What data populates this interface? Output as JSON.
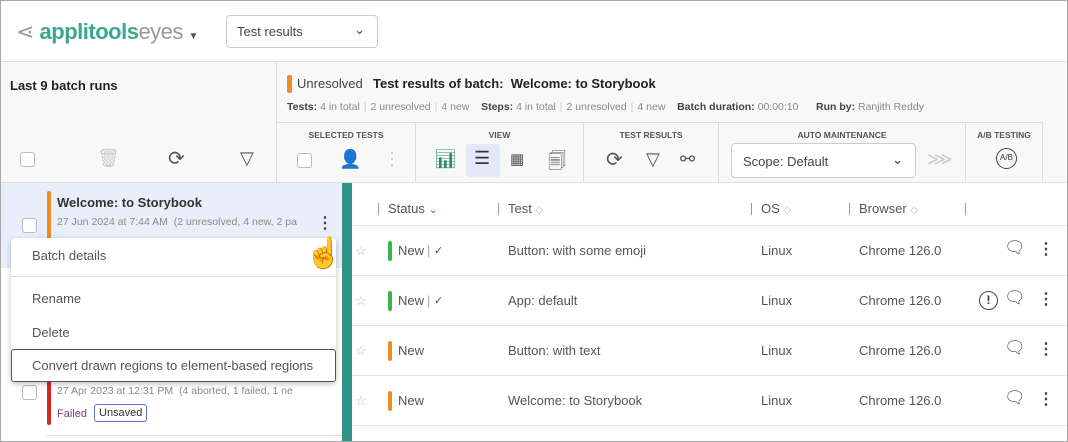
{
  "header": {
    "logo_main": "applitools",
    "logo_sub": "eyes",
    "page_select": "Test results"
  },
  "left": {
    "title": "Last 9 batch runs",
    "batches": [
      {
        "name": "Welcome: to Storybook",
        "date": "27 Jun 2024 at 7:44 AM",
        "summary": "(2 unresolved, 4 new, 2 pa",
        "color": "#f28c1e"
      },
      {
        "date": "27 Apr 2023 at 12:31 PM",
        "summary": "(4 aborted, 1 failed, 1 ne",
        "status": "Failed",
        "badge": "Unsaved",
        "color": "#d9261c"
      }
    ]
  },
  "batch": {
    "status": "Unresolved",
    "title": "Test results of batch:  Welcome: to Storybook",
    "tests_label": "Tests:",
    "tests_total": "4 in total",
    "tests_unresolved": "2 unresolved",
    "tests_new": "4 new",
    "steps_label": "Steps:",
    "steps_total": "4 in total",
    "steps_unresolved": "2 unresolved",
    "steps_new": "4 new",
    "duration_label": "Batch duration:",
    "duration": "00:00:10",
    "runby_label": "Run by:",
    "runby": "Ranjith Reddy"
  },
  "toolbar": {
    "selected_tests": "SELECTED TESTS",
    "view": "VIEW",
    "test_results": "TEST RESULTS",
    "auto_maintenance": "AUTO MAINTENANCE",
    "ab_testing": "A/B TESTING",
    "scope": "Scope: Default"
  },
  "menu": {
    "items": [
      "Batch details",
      "Rename",
      "Delete",
      "Convert drawn regions to element-based regions"
    ]
  },
  "table": {
    "headers": [
      "Status",
      "Test",
      "OS",
      "Browser"
    ],
    "rows": [
      {
        "status": "New",
        "accepted": true,
        "color": "#3bb54a",
        "test": "Button: with some emoji",
        "os": "Linux",
        "browser": "Chrome 126.0",
        "warning": false
      },
      {
        "status": "New",
        "accepted": true,
        "color": "#3bb54a",
        "test": "App: default",
        "os": "Linux",
        "browser": "Chrome 126.0",
        "warning": true
      },
      {
        "status": "New",
        "accepted": false,
        "color": "#f28c1e",
        "test": "Button: with text",
        "os": "Linux",
        "browser": "Chrome 126.0",
        "warning": false
      },
      {
        "status": "New",
        "accepted": false,
        "color": "#f28c1e",
        "test": "Welcome: to Storybook",
        "os": "Linux",
        "browser": "Chrome 126.0",
        "warning": false
      }
    ]
  },
  "colors": {
    "brand": "#3aa891",
    "divider": "#2e9488",
    "selected_bg": "#e8eefa"
  }
}
